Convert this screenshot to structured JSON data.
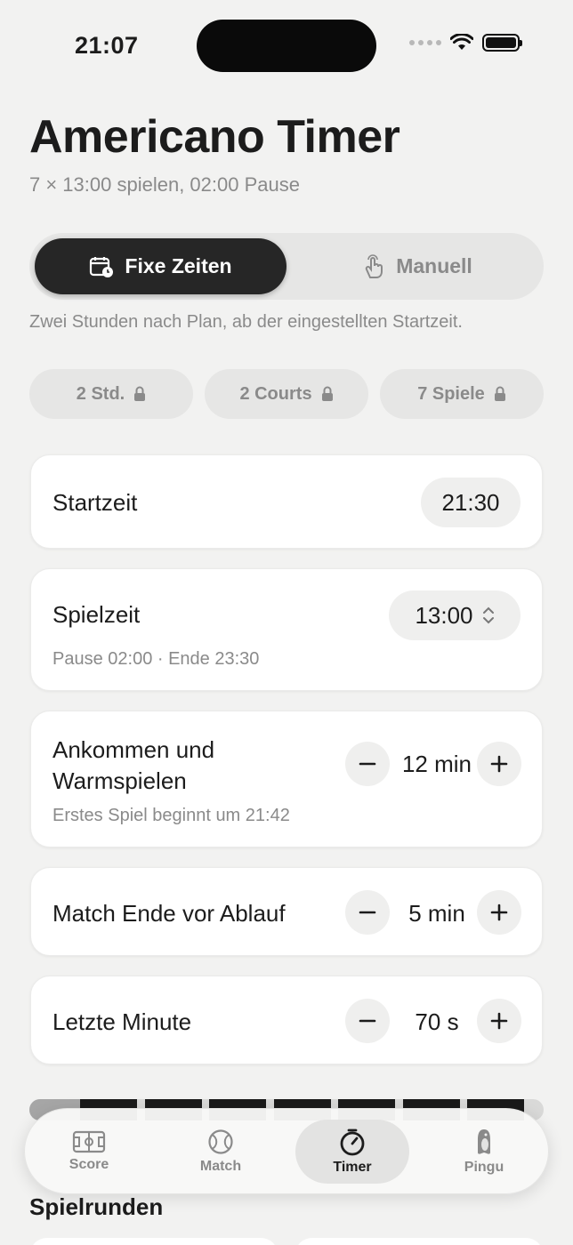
{
  "status_bar": {
    "time": "21:07"
  },
  "header": {
    "title": "Americano Timer",
    "subtitle": "7 × 13:00 spielen, 02:00 Pause"
  },
  "mode_switch": {
    "options": [
      {
        "label": "Fixe Zeiten",
        "icon": "calendar-clock-icon",
        "selected": true
      },
      {
        "label": "Manuell",
        "icon": "hand-tap-icon",
        "selected": false
      }
    ],
    "hint": "Zwei Stunden nach Plan, ab der eingestellten Startzeit."
  },
  "chips": [
    {
      "label": "2 Std.",
      "icon": "lock-icon"
    },
    {
      "label": "2 Courts",
      "icon": "lock-icon"
    },
    {
      "label": "7 Spiele",
      "icon": "lock-icon"
    }
  ],
  "settings": {
    "start_time": {
      "label": "Startzeit",
      "value": "21:30"
    },
    "play_time": {
      "label": "Spielzeit",
      "value": "13:00",
      "sub": "Pause 02:00 · Ende 23:30"
    },
    "warmup": {
      "label_line1": "Ankommen und",
      "label_line2": "Warmspielen",
      "value": "12 min",
      "sub": "Erstes Spiel beginnt um 21:42"
    },
    "match_end": {
      "label": "Match Ende vor Ablauf",
      "value": "5 min"
    },
    "last_minute": {
      "label": "Letzte Minute",
      "value": "70 s"
    }
  },
  "timeline": {
    "games": 7
  },
  "section": {
    "title": "Spielrunden"
  },
  "tabbar": {
    "tabs": [
      {
        "label": "Score",
        "icon": "scoreboard-icon",
        "active": false
      },
      {
        "label": "Match",
        "icon": "tennis-ball-icon",
        "active": false
      },
      {
        "label": "Timer",
        "icon": "timer-icon",
        "active": true
      },
      {
        "label": "Pingu",
        "icon": "penguin-icon",
        "active": false
      }
    ]
  },
  "colors": {
    "accent_dark": "#262626",
    "background": "#f2f2f1",
    "muted_text": "#8a8a8a"
  }
}
